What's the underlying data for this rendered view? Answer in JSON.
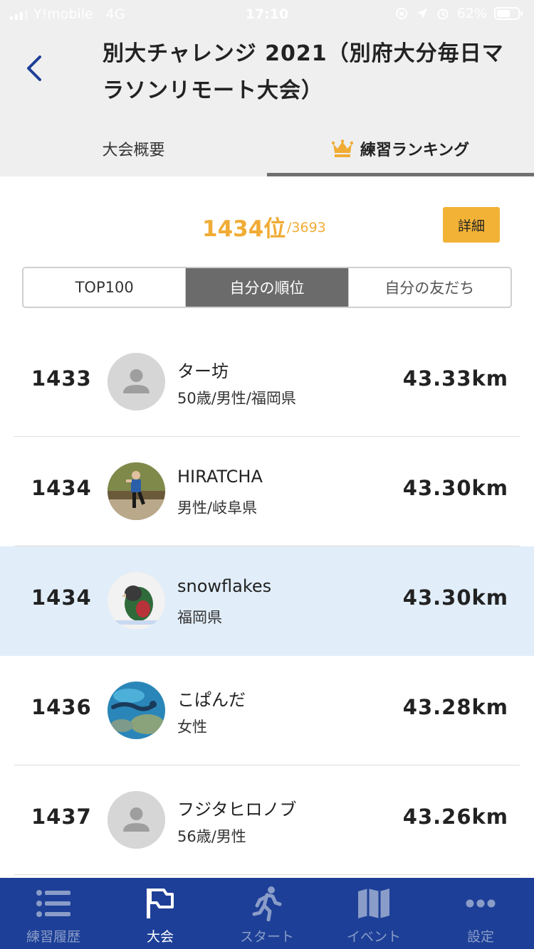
{
  "status_bar": {
    "carrier": "Y!mobile",
    "network": "4G",
    "time": "17:10",
    "battery": "62%"
  },
  "header": {
    "title": "別大チャレンジ 2021（別府大分毎日マラソンリモート大会）",
    "tabs": [
      {
        "label": "大会概要",
        "active": false
      },
      {
        "label": "練習ランキング",
        "active": true,
        "icon": "crown-icon"
      }
    ]
  },
  "ranking": {
    "my_rank": "1434位",
    "total": "/3693",
    "detail_label": "詳細"
  },
  "segments": [
    {
      "label": "TOP100",
      "active": false
    },
    {
      "label": "自分の順位",
      "active": true
    },
    {
      "label": "自分の友だち",
      "active": false
    }
  ],
  "rows": [
    {
      "rank": "1433",
      "name": "ター坊",
      "sub": "50歳/男性/福岡県",
      "distance": "43.33km",
      "avatar": "default-avatar",
      "highlight": false
    },
    {
      "rank": "1434",
      "name": " HIRATCHA",
      "sub": "男性/岐阜県",
      "distance": "43.30km",
      "avatar": "runner-photo",
      "highlight": false
    },
    {
      "rank": "1434",
      "name": "snowflakes",
      "sub": "福岡県",
      "distance": "43.30km",
      "avatar": "parrot-photo",
      "highlight": true
    },
    {
      "rank": "1436",
      "name": "こぱんだ",
      "sub": "女性",
      "distance": "43.28km",
      "avatar": "underwater-photo",
      "highlight": false
    },
    {
      "rank": "1437",
      "name": "フジタヒロノブ",
      "sub": "56歳/男性",
      "distance": "43.26km",
      "avatar": "default-avatar",
      "highlight": false
    }
  ],
  "tabbar": [
    {
      "label": "練習履歴",
      "icon": "list-icon",
      "active": false
    },
    {
      "label": "大会",
      "icon": "flag-icon",
      "active": true
    },
    {
      "label": "スタート",
      "icon": "runner-icon",
      "active": false
    },
    {
      "label": "イベント",
      "icon": "map-icon",
      "active": false
    },
    {
      "label": "設定",
      "icon": "more-dots-icon",
      "active": false
    }
  ],
  "colors": {
    "accent_orange": "#f0ac35",
    "tabbar_blue": "#1d3f97",
    "highlight_row": "#e1eefa",
    "back_arrow": "#1d3f97"
  }
}
